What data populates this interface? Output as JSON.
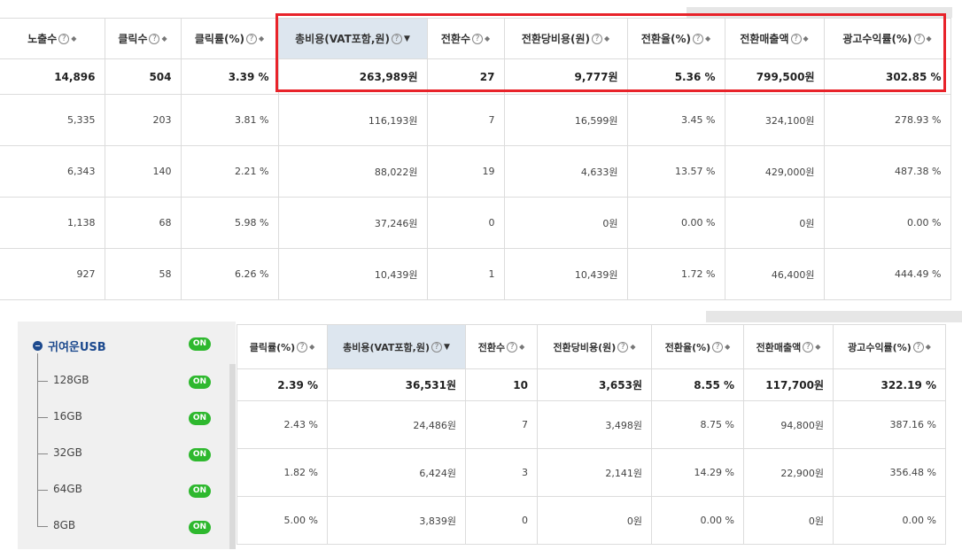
{
  "top_table": {
    "headers": [
      {
        "label": "노출수",
        "help": "?",
        "sort": "◆"
      },
      {
        "label": "클릭수",
        "help": "?",
        "sort": "◆"
      },
      {
        "label": "클릭률(%)",
        "help": "?",
        "sort": "◆"
      },
      {
        "label": "총비용(VAT포함,원)",
        "help": "?",
        "sort": "▼"
      },
      {
        "label": "전환수",
        "help": "?",
        "sort": "◆"
      },
      {
        "label": "전환당비용(원)",
        "help": "?",
        "sort": "◆"
      },
      {
        "label": "전환율(%)",
        "help": "?",
        "sort": "◆"
      },
      {
        "label": "전환매출액",
        "help": "?",
        "sort": "◆"
      },
      {
        "label": "광고수익률(%)",
        "help": "?",
        "sort": "◆"
      }
    ],
    "summary": [
      "14,896",
      "504",
      "3.39 %",
      "263,989원",
      "27",
      "9,777원",
      "5.36 %",
      "799,500원",
      "302.85 %"
    ],
    "rows": [
      [
        "5,335",
        "203",
        "3.81 %",
        "116,193원",
        "7",
        "16,599원",
        "3.45 %",
        "324,100원",
        "278.93 %"
      ],
      [
        "6,343",
        "140",
        "2.21 %",
        "88,022원",
        "19",
        "4,633원",
        "13.57 %",
        "429,000원",
        "487.38 %"
      ],
      [
        "1,138",
        "68",
        "5.98 %",
        "37,246원",
        "0",
        "0원",
        "0.00 %",
        "0원",
        "0.00 %"
      ],
      [
        "927",
        "58",
        "6.26 %",
        "10,439원",
        "1",
        "10,439원",
        "1.72 %",
        "46,400원",
        "444.49 %"
      ]
    ]
  },
  "sidebar": {
    "group": {
      "label": "귀여운USB",
      "toggle": "ON"
    },
    "children": [
      {
        "label": "128GB",
        "toggle": "ON"
      },
      {
        "label": "16GB",
        "toggle": "ON"
      },
      {
        "label": "32GB",
        "toggle": "ON"
      },
      {
        "label": "64GB",
        "toggle": "ON"
      },
      {
        "label": "8GB",
        "toggle": "ON"
      }
    ]
  },
  "bottom_table": {
    "headers": [
      {
        "label": "클릭률(%)",
        "help": "?",
        "sort": "◆"
      },
      {
        "label": "총비용(VAT포함,원)",
        "help": "?",
        "sort": "▼"
      },
      {
        "label": "전환수",
        "help": "?",
        "sort": "◆"
      },
      {
        "label": "전환당비용(원)",
        "help": "?",
        "sort": "◆"
      },
      {
        "label": "전환율(%)",
        "help": "?",
        "sort": "◆"
      },
      {
        "label": "전환매출액",
        "help": "?",
        "sort": "◆"
      },
      {
        "label": "광고수익률(%)",
        "help": "?",
        "sort": "◆"
      }
    ],
    "summary": [
      "2.39 %",
      "36,531원",
      "10",
      "3,653원",
      "8.55 %",
      "117,700원",
      "322.19 %"
    ],
    "rows": [
      [
        "2.43 %",
        "24,486원",
        "7",
        "3,498원",
        "8.75 %",
        "94,800원",
        "387.16 %"
      ],
      [
        "1.82 %",
        "6,424원",
        "3",
        "2,141원",
        "14.29 %",
        "22,900원",
        "356.48 %"
      ],
      [
        "5.00 %",
        "3,839원",
        "0",
        "0원",
        "0.00 %",
        "0원",
        "0.00 %"
      ]
    ]
  },
  "colors": {
    "highlight_border": "#e8232a",
    "toggle_on": "#2eb82e",
    "sorted_header": "#dde6ef",
    "group_label": "#1d4a8e"
  }
}
